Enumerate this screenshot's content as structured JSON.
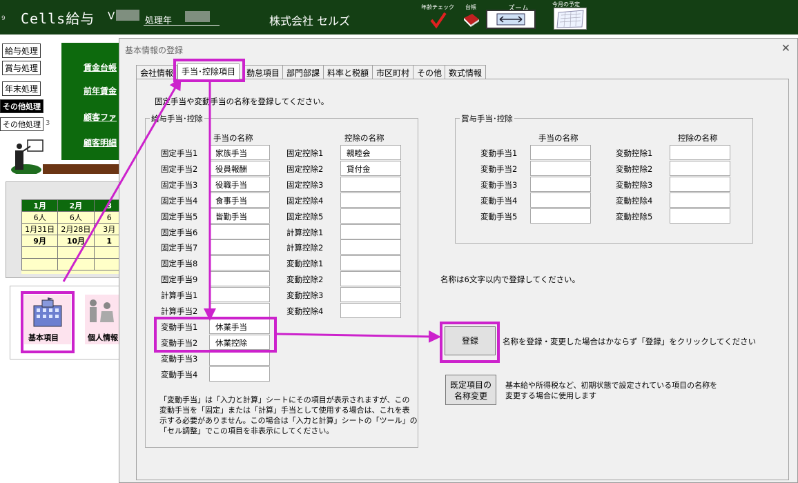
{
  "header": {
    "app_title": "Cells給与",
    "version_prefix": "V",
    "year_label": "処理年",
    "company": "株式会社 セルズ",
    "row_mark": "9",
    "toolbar": {
      "age_check": "年齢チェック",
      "ledger": "台帳",
      "zoom": "ズーム",
      "monthly_plan": "今月の予定"
    }
  },
  "sidebar": {
    "salary": "給与処理",
    "bonus": "賞与処理",
    "year_end": "年末処理",
    "other1": "その他処理",
    "other2": "その他処理",
    "other2_mark": "3",
    "links": [
      "賃金台帳",
      "前年賃金",
      "顧客ファ",
      "顧客明細"
    ]
  },
  "calendar": {
    "headers": [
      "1月",
      "2月",
      "3"
    ],
    "rows": [
      [
        "6人",
        "6人",
        "6"
      ],
      [
        "1月31日",
        "2月28日",
        "3月"
      ],
      [
        "9月",
        "10月",
        "1"
      ],
      [
        "",
        "",
        ""
      ],
      [
        "",
        "",
        ""
      ]
    ]
  },
  "icons": {
    "basic": "基本項目",
    "personal": "個人情報"
  },
  "dialog": {
    "title": "基本情報の登録",
    "close": "✕",
    "tabs": [
      "会社情報",
      "手当･控除項目",
      "勤怠項目",
      "部門部課",
      "料率と税額",
      "市区町村",
      "その他",
      "数式情報"
    ],
    "active_tab": 1,
    "instruction": "固定手当や変動手当の名称を登録してください。",
    "salary_group": {
      "caption": "給与手当･控除",
      "allowance_header": "手当の名称",
      "deduction_header": "控除の名称",
      "allowances": [
        {
          "label": "固定手当1",
          "value": "家族手当"
        },
        {
          "label": "固定手当2",
          "value": "役員報酬"
        },
        {
          "label": "固定手当3",
          "value": "役職手当"
        },
        {
          "label": "固定手当4",
          "value": "食事手当"
        },
        {
          "label": "固定手当5",
          "value": "皆勤手当"
        },
        {
          "label": "固定手当6",
          "value": ""
        },
        {
          "label": "固定手当7",
          "value": ""
        },
        {
          "label": "固定手当8",
          "value": ""
        },
        {
          "label": "固定手当9",
          "value": ""
        },
        {
          "label": "計算手当1",
          "value": ""
        },
        {
          "label": "計算手当2",
          "value": ""
        },
        {
          "label": "変動手当1",
          "value": "休業手当"
        },
        {
          "label": "変動手当2",
          "value": "休業控除"
        },
        {
          "label": "変動手当3",
          "value": ""
        },
        {
          "label": "変動手当4",
          "value": ""
        }
      ],
      "deductions": [
        {
          "label": "固定控除1",
          "value": "親睦会"
        },
        {
          "label": "固定控除2",
          "value": "貸付金"
        },
        {
          "label": "固定控除3",
          "value": ""
        },
        {
          "label": "固定控除4",
          "value": ""
        },
        {
          "label": "固定控除5",
          "value": ""
        },
        {
          "label": "計算控除1",
          "value": ""
        },
        {
          "label": "計算控除2",
          "value": ""
        },
        {
          "label": "変動控除1",
          "value": ""
        },
        {
          "label": "変動控除2",
          "value": ""
        },
        {
          "label": "変動控除3",
          "value": ""
        },
        {
          "label": "変動控除4",
          "value": ""
        }
      ],
      "note": [
        "「変動手当」は「入力と計算」シートにその項目が表示されますが、この",
        "変動手当を「固定」または「計算」手当として使用する場合は、これを表",
        "示する必要がありません。この場合は「入力と計算」シートの「ツール」の",
        "「セル調整」でこの項目を非表示にしてください。"
      ]
    },
    "bonus_group": {
      "caption": "賞与手当･控除",
      "allowance_header": "手当の名称",
      "deduction_header": "控除の名称",
      "allowances": [
        {
          "label": "変動手当1",
          "value": ""
        },
        {
          "label": "変動手当2",
          "value": ""
        },
        {
          "label": "変動手当3",
          "value": ""
        },
        {
          "label": "変動手当4",
          "value": ""
        },
        {
          "label": "変動手当5",
          "value": ""
        }
      ],
      "deductions": [
        {
          "label": "変動控除1",
          "value": ""
        },
        {
          "label": "変動控除2",
          "value": ""
        },
        {
          "label": "変動控除3",
          "value": ""
        },
        {
          "label": "変動控除4",
          "value": ""
        },
        {
          "label": "変動控除5",
          "value": ""
        }
      ]
    },
    "length_note": "名称は6文字以内で登録してください。",
    "register_button": "登録",
    "register_note": "名称を登録・変更した場合はかならず「登録」をクリックしてください",
    "default_button": [
      "既定項目の",
      "名称変更"
    ],
    "default_note": [
      "基本給や所得税など、初期状態で設定されている項目の名称を",
      "変更する場合に使用します"
    ]
  },
  "colors": {
    "header_bg": "#143f14",
    "panel_green": "#0d6a0d",
    "highlight": "#cc22cc",
    "dialog_bg": "#f0f0f0"
  }
}
